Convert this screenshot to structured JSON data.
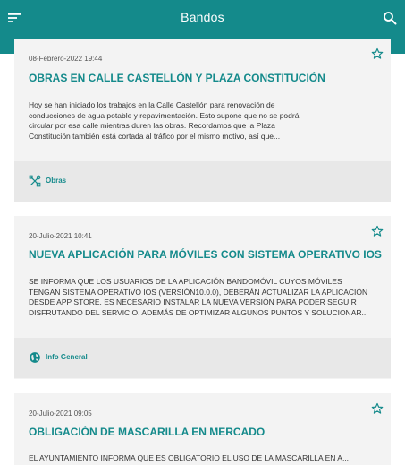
{
  "header": {
    "title": "Bandos",
    "menu_icon": "menu-icon",
    "search_icon": "search-icon"
  },
  "colors": {
    "accent": "#148a8b",
    "card_bg": "#f3f3f3",
    "footer_bg": "#e8e8e8"
  },
  "cards": [
    {
      "date": "08-Febrero-2022 19:44",
      "title": "OBRAS EN CALLE CASTELLÓN Y PLAZA CONSTITUCIÓN",
      "lines": [
        "Hoy se han iniciado los trabajos en la Calle Castellón para renovación de",
        "conducciones de agua potable y repavimentación. Esto supone que no se podrá",
        "circular por esa calle mientras duren las obras. Recordamos que la Plaza",
        "Constitución también está cortada al tráfico por el mismo motivo, así que..."
      ],
      "category": "Obras",
      "category_icon": "tools-icon"
    },
    {
      "date": "20-Julio-2021 10:41",
      "title": "NUEVA APLICACIÓN PARA MÓVILES CON SISTEMA OPERATIVO IOS",
      "lines": [
        "SE INFORMA QUE LOS USUARIOS DE LA APLICACIÓN BANDOMÓVIL CUYOS MÓVILES",
        "TENGAN SISTEMA OPERATIVO IOS (VERSIÓN10.0.0), DEBERÁN ACTUALIZAR LA APLICACIÓN",
        "DESDE APP STORE. ES NECESARIO INSTALAR LA NUEVA VERSIÓN PARA PODER SEGUIR",
        "DISFRUTANDO DEL SERVICIO. ADEMÁS DE OPTIMIZAR ALGUNOS PUNTOS Y SOLUCIONAR..."
      ],
      "category": "Info General",
      "category_icon": "globe-icon"
    },
    {
      "date": "20-Julio-2021 09:05",
      "title": "OBLIGACIÓN DE MASCARILLA EN MERCADO",
      "lines": [
        "EL AYUNTAMIENTO INFORMA QUE ES OBLIGATORIO EL USO DE LA MASCARILLA EN A..."
      ]
    }
  ]
}
